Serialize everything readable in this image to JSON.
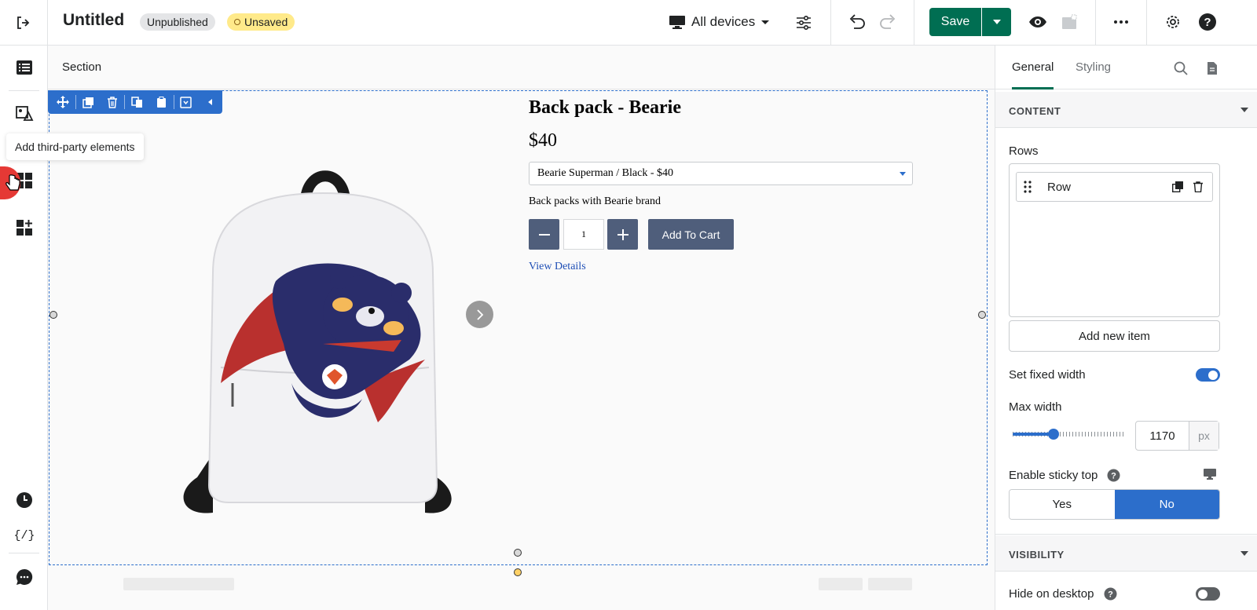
{
  "topbar": {
    "title": "Untitled",
    "status_badge": "Unpublished",
    "saved_badge": "Unsaved",
    "devices_label": "All devices",
    "save_label": "Save"
  },
  "leftbar": {
    "tooltip": "Add third-party elements"
  },
  "canvas": {
    "section_label": "Section",
    "product": {
      "title": "Back pack - Bearie",
      "price": "$40",
      "variant": "Bearie Superman / Black - $40",
      "description": "Back packs with Bearie brand",
      "quantity": "1",
      "add_to_cart": "Add To Cart",
      "view_details": "View Details"
    }
  },
  "right_panel": {
    "tabs": [
      "General",
      "Styling"
    ],
    "content_header": "CONTENT",
    "rows_label": "Rows",
    "row_item": "Row",
    "add_new_item": "Add new item",
    "set_fixed_width": "Set fixed width",
    "set_fixed_width_on": true,
    "max_width_label": "Max width",
    "max_width_value": "1170",
    "max_width_unit": "px",
    "sticky_label": "Enable sticky top",
    "sticky_options": [
      "Yes",
      "No"
    ],
    "sticky_selected": "No",
    "visibility_header": "VISIBILITY",
    "hide_desktop": "Hide on desktop",
    "hide_desktop_on": false
  },
  "colors": {
    "accent_green": "#006e52",
    "selection_blue": "#2c6ecb",
    "cart_button": "#4f5e7b",
    "unsaved_badge": "#ffea8a"
  }
}
